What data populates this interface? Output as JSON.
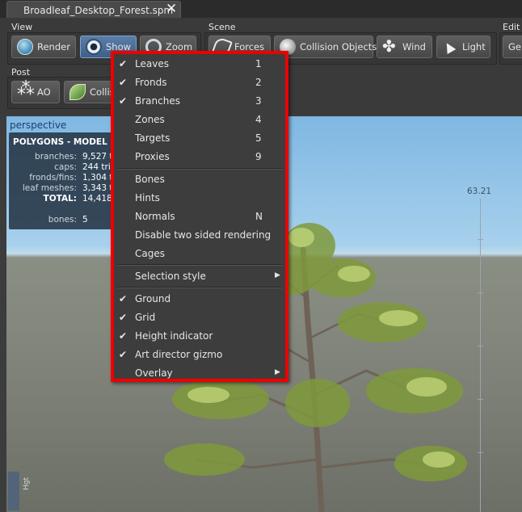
{
  "tab": {
    "title": "Broadleaf_Desktop_Forest.spm",
    "close": "✕"
  },
  "toolbar": {
    "view": {
      "label": "View",
      "buttons": [
        {
          "label": "Render",
          "icon": "globe-icon"
        },
        {
          "label": "Show",
          "icon": "eye-icon"
        },
        {
          "label": "Zoom",
          "icon": "zoom-icon"
        }
      ]
    },
    "scene": {
      "label": "Scene",
      "buttons": [
        {
          "label": "Forces",
          "icon": "forces-icon"
        },
        {
          "label": "Collision Objects",
          "icon": "collision-sphere-icon"
        },
        {
          "label": "Wind",
          "icon": "wind-icon"
        },
        {
          "label": "Light",
          "icon": "light-icon"
        }
      ]
    },
    "edit": {
      "label": "Edit",
      "partial_button": "Gen"
    },
    "post": {
      "label": "Post",
      "buttons": [
        {
          "label": "AO",
          "icon": "ao-icon"
        },
        {
          "label": "Collis",
          "icon": "leaf-collision-icon"
        }
      ]
    }
  },
  "viewport": {
    "label": "perspective",
    "stats": {
      "title": "POLYGONS - MODEL",
      "rows": [
        {
          "label": "branches:",
          "value": "9,527 t"
        },
        {
          "label": "caps:",
          "value": "244 tri"
        },
        {
          "label": "fronds/fins:",
          "value": "1,304 t"
        },
        {
          "label": "leaf meshes:",
          "value": "3,343 t"
        },
        {
          "label": "TOTAL:",
          "value": "14,418"
        },
        {
          "label": "bones:",
          "value": "5"
        }
      ]
    },
    "height_indicator_value": "63.21",
    "height_label": "Hgt"
  },
  "menu": {
    "items": [
      {
        "label": "Leaves",
        "checked": "✔",
        "shortcut": "1"
      },
      {
        "label": "Fronds",
        "checked": "✔",
        "shortcut": "2"
      },
      {
        "label": "Branches",
        "checked": "✔",
        "shortcut": "3"
      },
      {
        "label": "Zones",
        "checked": "",
        "shortcut": "4"
      },
      {
        "label": "Targets",
        "checked": "",
        "shortcut": "5"
      },
      {
        "label": "Proxies",
        "checked": "",
        "shortcut": "9"
      },
      {
        "label": "Bones",
        "checked": "",
        "shortcut": ""
      },
      {
        "label": "Hints",
        "checked": "",
        "shortcut": ""
      },
      {
        "label": "Normals",
        "checked": "",
        "shortcut": "N"
      },
      {
        "label": "Disable two sided rendering",
        "checked": "",
        "shortcut": ""
      },
      {
        "label": "Cages",
        "checked": "",
        "shortcut": ""
      },
      {
        "label": "Selection style",
        "checked": "",
        "shortcut": "",
        "submenu": "▶"
      },
      {
        "label": "Ground",
        "checked": "✔",
        "shortcut": ""
      },
      {
        "label": "Grid",
        "checked": "✔",
        "shortcut": ""
      },
      {
        "label": "Height indicator",
        "checked": "✔",
        "shortcut": ""
      },
      {
        "label": "Art director gizmo",
        "checked": "✔",
        "shortcut": ""
      },
      {
        "label": "Overlay",
        "checked": "",
        "shortcut": "",
        "submenu": "▶"
      }
    ]
  },
  "colors": {
    "menu_highlight_border": "#ee0000",
    "active_button": "#4a6e98",
    "sky": "#a7d0ec",
    "ground": "#7d8076"
  }
}
